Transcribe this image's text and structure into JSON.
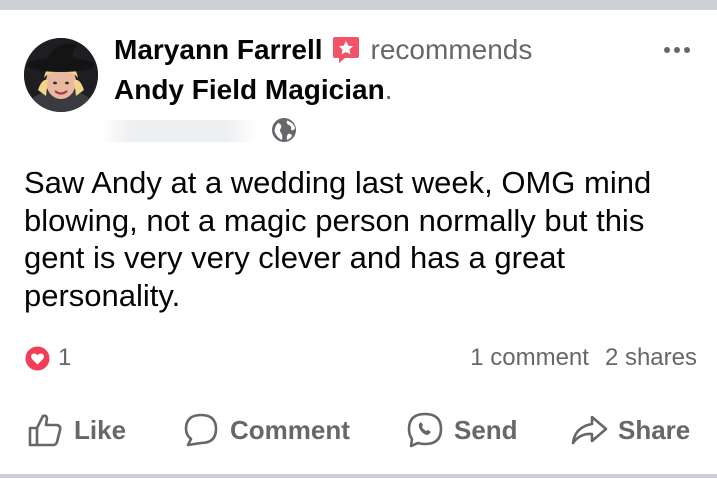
{
  "post": {
    "author": "Maryann Farrell",
    "action": "recommends",
    "page": "Andy Field Magician",
    "period": ".",
    "body": "Saw Andy at a wedding last week, OMG mind blowing, not a magic person normally but this gent is very very clever and has a great personality.",
    "privacy_icon": "globe-icon",
    "recommend_icon": "recommend-star-icon"
  },
  "engagement": {
    "reaction_icon": "heart-icon",
    "reaction_count": "1",
    "comments": "1 comment",
    "shares": "2 shares"
  },
  "actions": {
    "like": "Like",
    "comment": "Comment",
    "send": "Send",
    "share": "Share"
  },
  "colors": {
    "text_primary": "#050505",
    "text_secondary": "#65676b",
    "recommend_red": "#f35369",
    "divider": "#ccd0d5"
  }
}
